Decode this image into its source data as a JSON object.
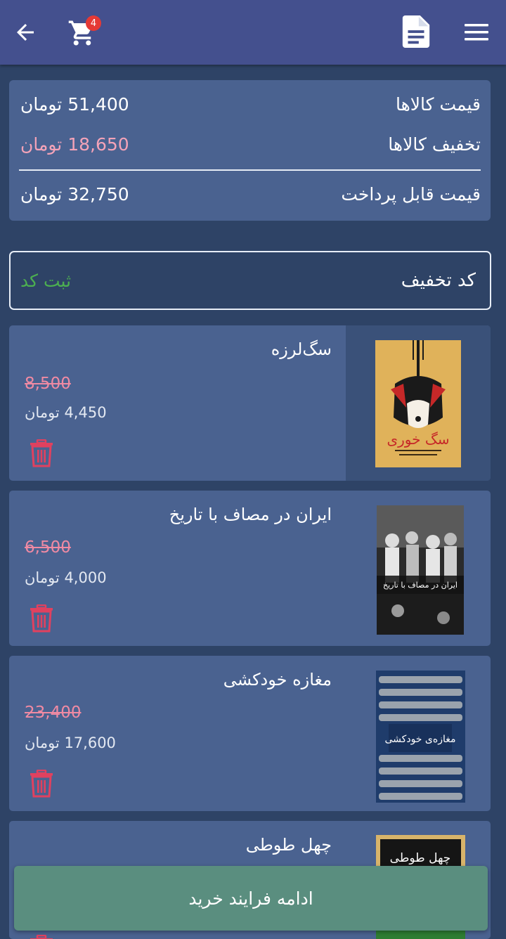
{
  "appbar": {
    "cart_count": "4",
    "icons": {
      "back": "arrow-left-icon",
      "cart": "cart-icon",
      "invoice": "document-icon",
      "menu": "hamburger-menu-icon"
    }
  },
  "summary": {
    "items_price_label": "قیمت کالاها",
    "items_price_value": "51,400 تومان",
    "discount_label": "تخفیف کالاها",
    "discount_value": "18,650 تومان",
    "payable_label": "قیمت قابل پرداخت",
    "payable_value": "32,750 تومان"
  },
  "coupon": {
    "label": "کد تخفیف",
    "submit": "ثبت کد"
  },
  "items": [
    {
      "title": "سگ‌لرزه",
      "old_price": "8,500",
      "new_price": "4,450 تومان",
      "cover_text": "سگ خوری"
    },
    {
      "title": "ایران در مصاف با تاریخ",
      "old_price": "6,500",
      "new_price": "4,000 تومان",
      "cover_text": "ایران در مصاف با تاریخ"
    },
    {
      "title": "مغازه خودکشی",
      "old_price": "23,400",
      "new_price": "17,600 تومان",
      "cover_text": "مغازه‌ی خودکشی"
    },
    {
      "title": "چهل طوطی",
      "cover_text": "چهل طوطی"
    }
  ],
  "proceed_button": "ادامه فرایند خرید",
  "colors": {
    "background": "#2e4366",
    "appbar": "#44508e",
    "card": "#4a6290",
    "discount": "#f4a3b8",
    "submit": "#4caf50",
    "trash": "#e0415f",
    "proceed": "#5a8e7f"
  }
}
